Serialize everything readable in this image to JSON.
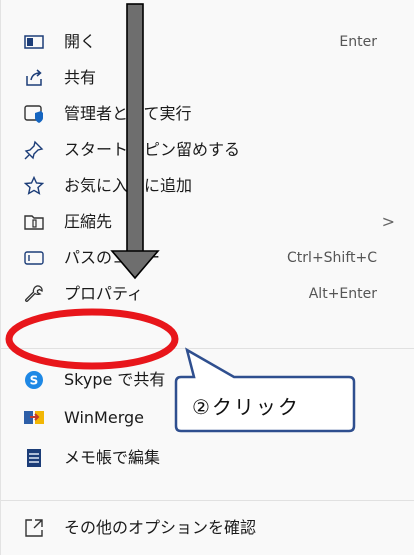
{
  "menu": {
    "items": [
      {
        "label": "開く",
        "shortcut": "Enter",
        "icon": "open-icon"
      },
      {
        "label": "共有",
        "icon": "share-icon"
      },
      {
        "label": "管理者として実行",
        "icon": "admin-shield-icon"
      },
      {
        "label": "スタートにピン留めする",
        "icon": "pin-icon"
      },
      {
        "label": "お気に入りに追加",
        "icon": "star-icon"
      },
      {
        "label": "圧縮先",
        "icon": "archive-icon",
        "has_submenu": true
      },
      {
        "label": "パスのコピー",
        "shortcut": "Ctrl+Shift+C",
        "icon": "copy-path-icon"
      },
      {
        "label": "プロパティ",
        "shortcut": "Alt+Enter",
        "icon": "wrench-icon"
      },
      {
        "label": "Skype で共有",
        "icon": "skype-icon"
      },
      {
        "label": "WinMerge",
        "icon": "winmerge-icon"
      },
      {
        "label": "メモ帳で編集",
        "icon": "notepad-icon"
      },
      {
        "label": "その他のオプションを確認",
        "icon": "more-options-icon"
      }
    ],
    "submenu_arrow": ">"
  },
  "annotation": {
    "callout_text": "②クリック",
    "highlight_color": "#e8161b",
    "arrow_color": "#6e6e6e",
    "callout_border": "#2f4f8f"
  }
}
